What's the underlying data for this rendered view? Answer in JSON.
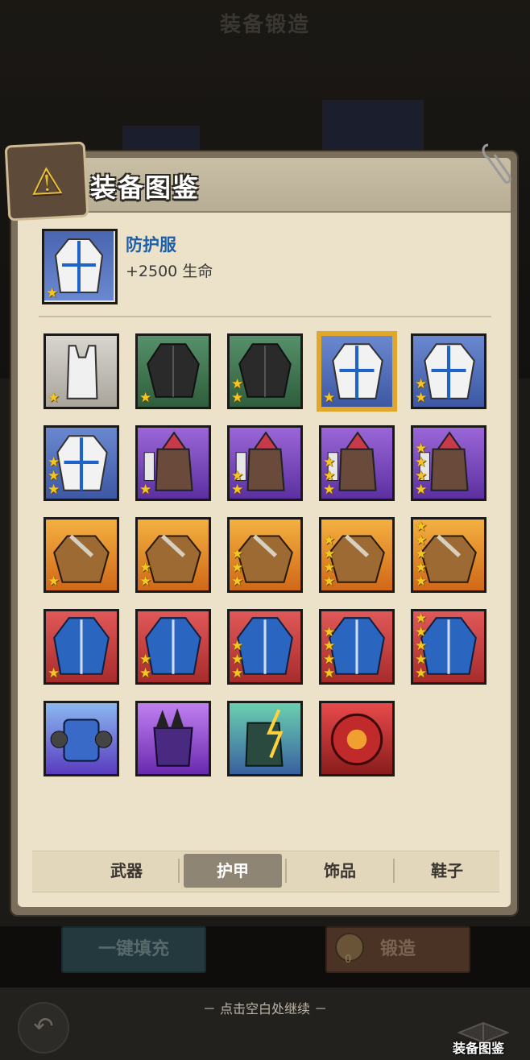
{
  "background": {
    "title": "装备锻造"
  },
  "panel": {
    "title": "装备图鉴",
    "badge_icon": "triangle-emblem-icon"
  },
  "selected_item": {
    "name": "防护服",
    "stat": "+2500 生命",
    "stars": 1,
    "icon": "protective-suit-icon"
  },
  "colors": {
    "grey": "#c9c6c0",
    "green": "#447a4f",
    "blue": "#5876c0",
    "purple": "#7a48b8",
    "orange": "#e08a2c",
    "red": "#c84040",
    "star": "#f5c623",
    "selected_border": "#e0a72a",
    "name_blue": "#1f5fa8"
  },
  "items": [
    {
      "rarity": "grey",
      "icon": "tank-top-icon",
      "stars": 1
    },
    {
      "rarity": "green",
      "icon": "black-jacket-icon",
      "stars": 1
    },
    {
      "rarity": "green",
      "icon": "black-jacket-icon",
      "stars": 2
    },
    {
      "rarity": "blue",
      "icon": "protective-suit-icon",
      "stars": 1,
      "selected": true
    },
    {
      "rarity": "blue",
      "icon": "protective-suit-icon",
      "stars": 2
    },
    {
      "rarity": "blue",
      "icon": "protective-suit-icon",
      "stars": 3
    },
    {
      "rarity": "purple",
      "icon": "hooded-vest-icon",
      "stars": 1
    },
    {
      "rarity": "purple",
      "icon": "hooded-vest-icon",
      "stars": 2
    },
    {
      "rarity": "purple",
      "icon": "hooded-vest-icon",
      "stars": 3
    },
    {
      "rarity": "purple",
      "icon": "hooded-vest-icon",
      "stars": 4
    },
    {
      "rarity": "orange",
      "icon": "leather-armor-icon",
      "stars": 1
    },
    {
      "rarity": "orange",
      "icon": "leather-armor-icon",
      "stars": 2
    },
    {
      "rarity": "orange",
      "icon": "leather-armor-icon",
      "stars": 3
    },
    {
      "rarity": "orange",
      "icon": "leather-armor-icon",
      "stars": 4
    },
    {
      "rarity": "orange",
      "icon": "leather-armor-icon",
      "stars": 5
    },
    {
      "rarity": "red",
      "icon": "blue-coat-icon",
      "stars": 1
    },
    {
      "rarity": "red",
      "icon": "blue-coat-icon",
      "stars": 2
    },
    {
      "rarity": "red",
      "icon": "blue-coat-icon",
      "stars": 3
    },
    {
      "rarity": "red",
      "icon": "blue-coat-icon",
      "stars": 4
    },
    {
      "rarity": "red",
      "icon": "blue-coat-icon",
      "stars": 5
    },
    {
      "rarity": "legend_blue",
      "icon": "mech-armor-icon",
      "stars": 0
    },
    {
      "rarity": "legend_purple",
      "icon": "spiked-armor-icon",
      "stars": 0
    },
    {
      "rarity": "legend_teal",
      "icon": "lightning-armor-icon",
      "stars": 0
    },
    {
      "rarity": "legend_red",
      "icon": "red-mech-armor-icon",
      "stars": 0
    }
  ],
  "tabs": [
    {
      "label": "武器",
      "active": false
    },
    {
      "label": "护甲",
      "active": true
    },
    {
      "label": "饰品",
      "active": false
    },
    {
      "label": "鞋子",
      "active": false
    }
  ],
  "buttons": {
    "fill": "一键填充",
    "forge": "锻造",
    "forge_cost": "0"
  },
  "footer": {
    "hint": "－  点击空白处继续  －",
    "codex_label": "装备图鉴",
    "back_icon": "back-arrow-icon"
  }
}
